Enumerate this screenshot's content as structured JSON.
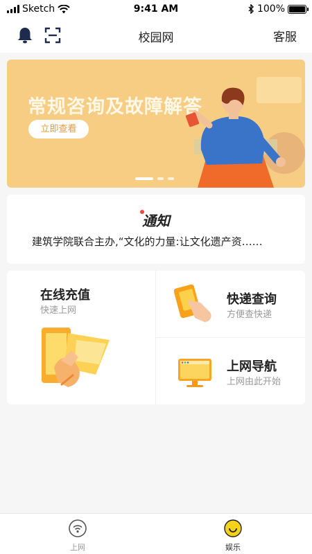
{
  "status_bar": {
    "carrier": "Sketch",
    "time": "9:41 AM",
    "battery": "100%"
  },
  "navbar": {
    "title": "校园网",
    "right_label": "客服"
  },
  "banner": {
    "headline": "常规咨询及故障解答",
    "cta": "立即查看",
    "page_count": 3,
    "active_page": 1
  },
  "notice": {
    "badge": "通知",
    "text": "建筑学院联合主办,“文化的力量:让文化遗产资……"
  },
  "features": {
    "recharge": {
      "title": "在线充值",
      "subtitle": "快速上网"
    },
    "express": {
      "title": "快递查询",
      "subtitle": "方便查快递"
    },
    "navigation": {
      "title": "上网导航",
      "subtitle": "上网由此开始"
    }
  },
  "tabbar": {
    "items": [
      {
        "label": "上网",
        "icon": "wifi-icon",
        "active": false
      },
      {
        "label": "娱乐",
        "icon": "smiley-icon",
        "active": true
      }
    ]
  },
  "colors": {
    "accent": "#f6cd82",
    "icon_navy": "#1e2b4f",
    "active_yellow": "#f7d21b",
    "notice_red": "#ee4a3d"
  }
}
